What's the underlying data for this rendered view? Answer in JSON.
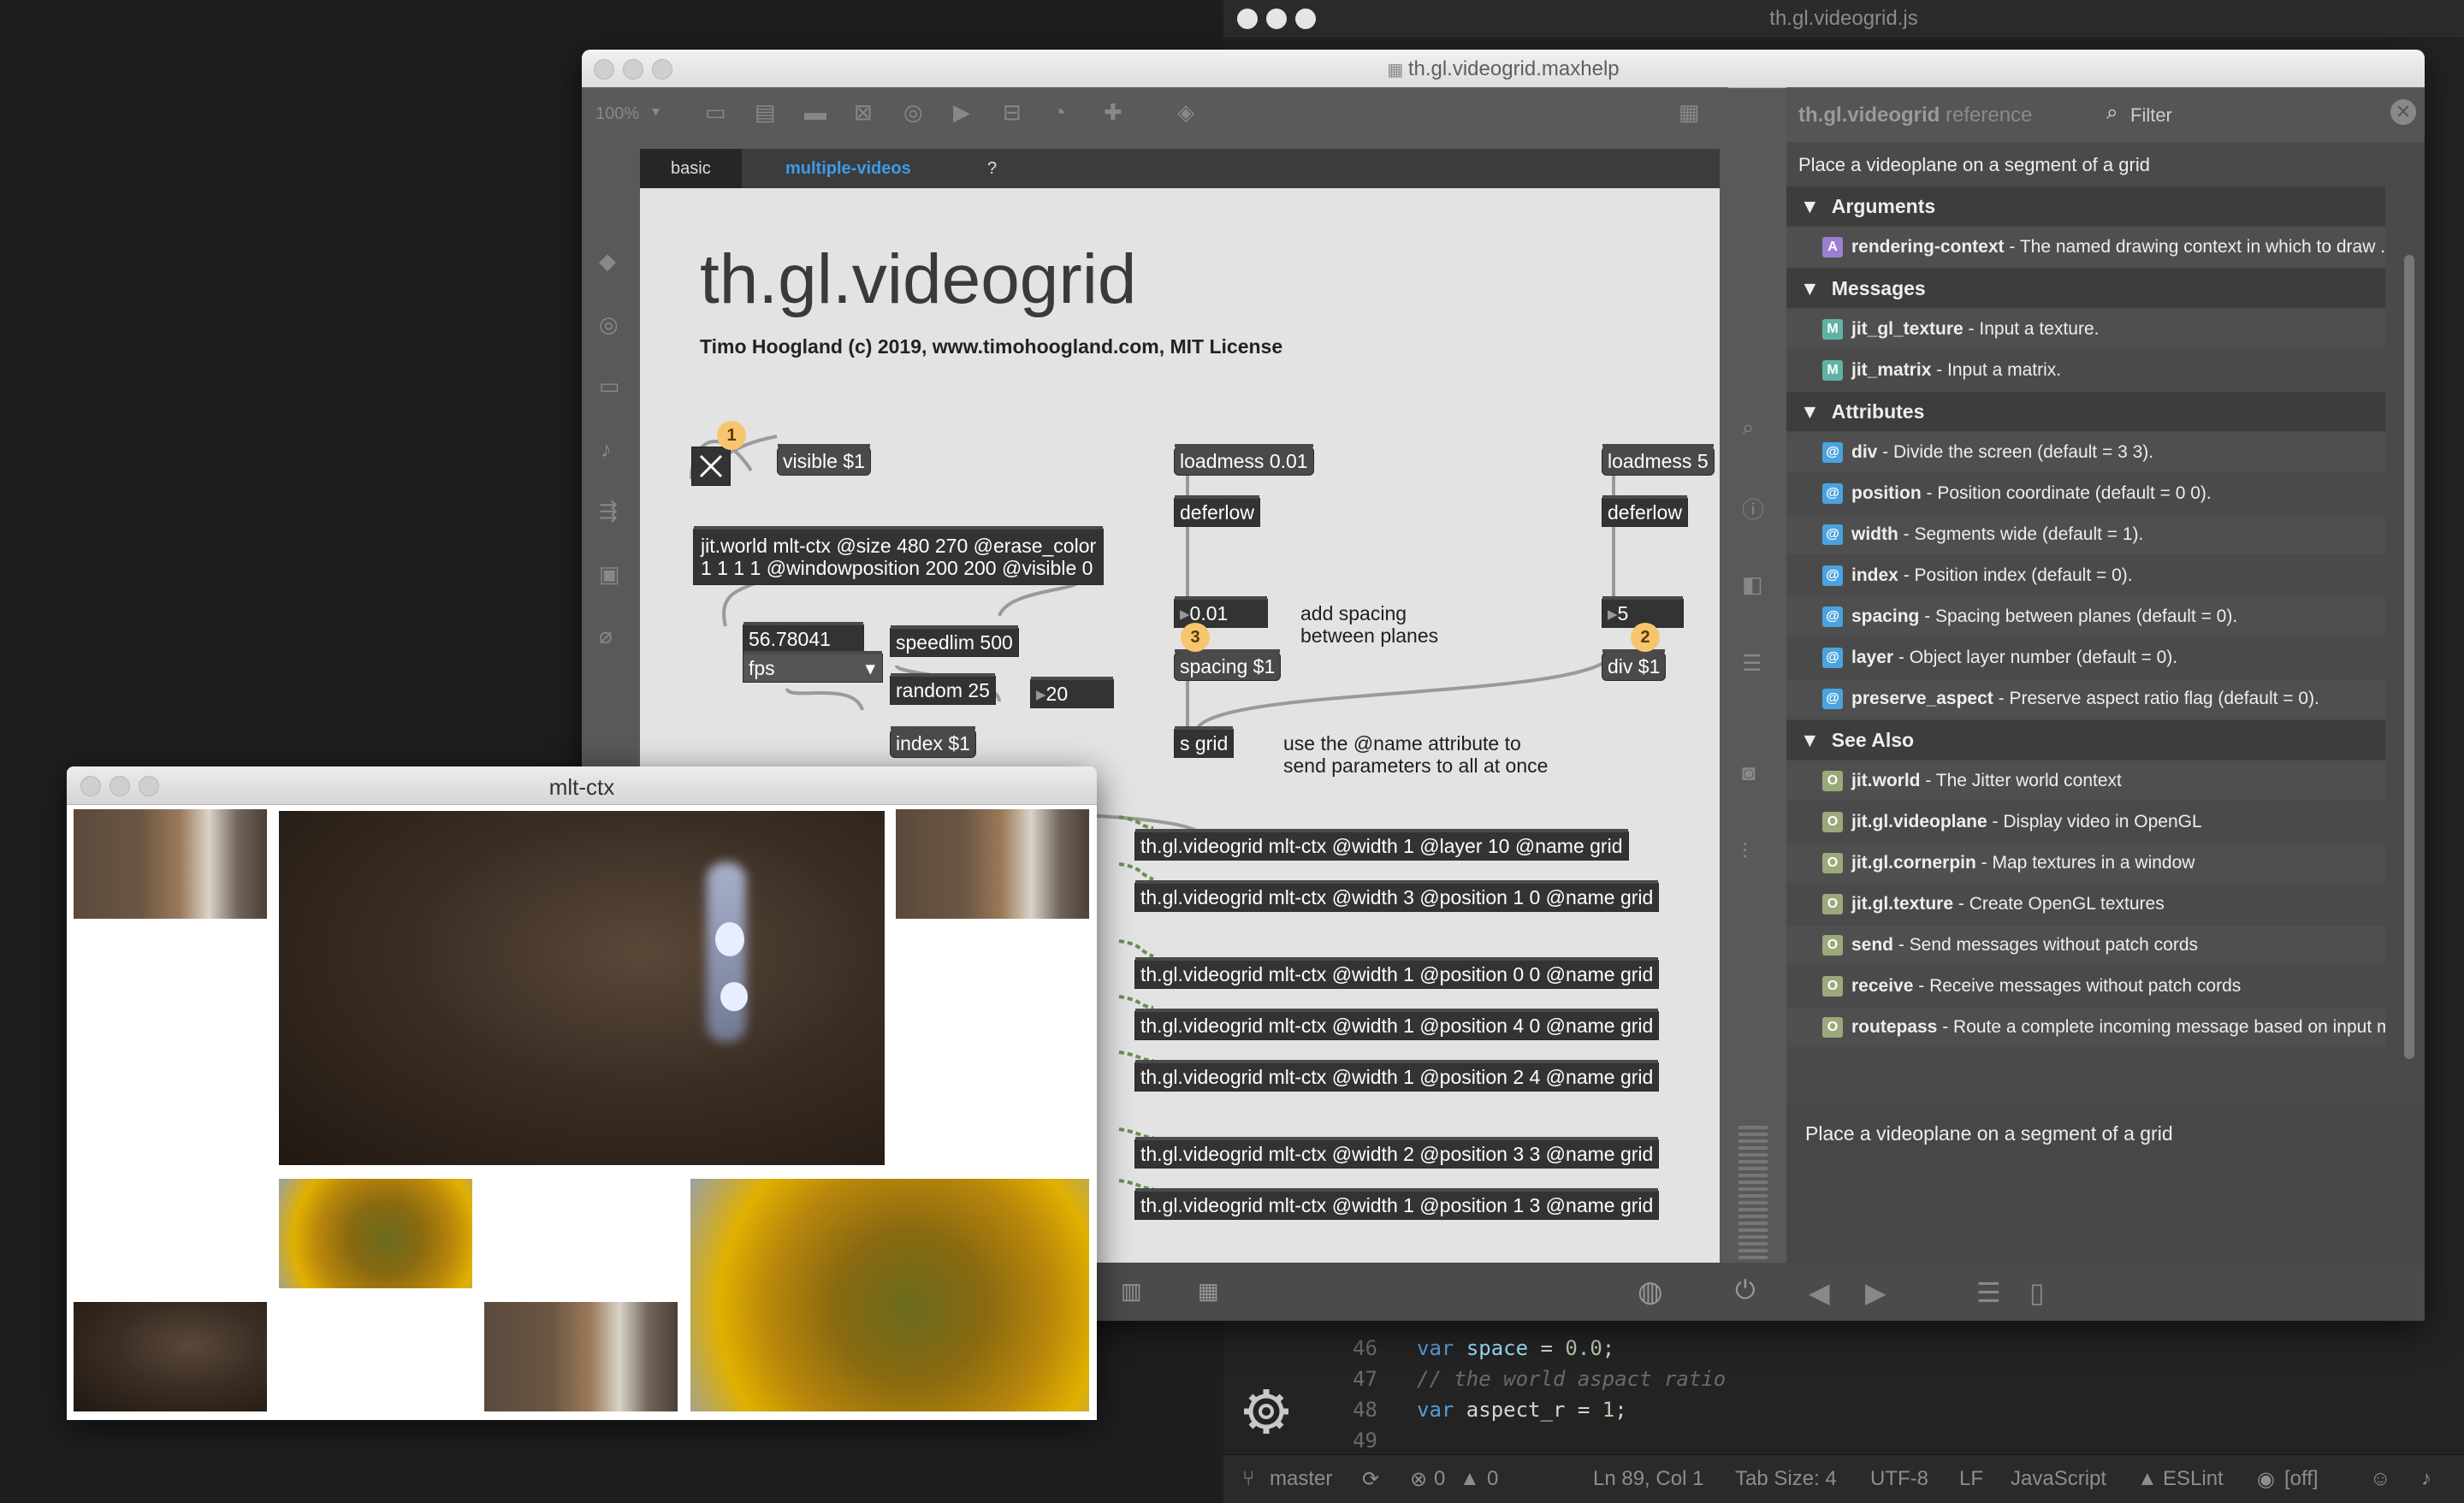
{
  "editor": {
    "title": "th.gl.videogrid.js",
    "lines": [
      {
        "num": "46",
        "text": "var space = 0.0;"
      },
      {
        "num": "47",
        "text": "// the world aspact ratio"
      },
      {
        "num": "48",
        "text": "var aspect_r = 1;"
      },
      {
        "num": "49",
        "text": ""
      }
    ],
    "status": {
      "branch": "master",
      "errors": "0",
      "warnings": "0",
      "position": "Ln 89, Col 1",
      "tabsize": "Tab Size: 4",
      "encoding": "UTF-8",
      "eol": "LF",
      "language": "JavaScript",
      "lint": "ESLint",
      "off": "[off]"
    }
  },
  "max": {
    "title": "th.gl.videogrid.maxhelp",
    "zoom": "100%",
    "tabs": [
      "basic",
      "multiple-videos",
      "?"
    ],
    "patch": {
      "title": "th.gl.videogrid",
      "subtitle": "Timo Hoogland (c) 2019, www.timohoogland.com, MIT License",
      "objects": {
        "visible": "visible $1",
        "jitworld1": "jit.world mlt-ctx @size 480 270 @erase_color",
        "jitworld2": "1 1 1 1 @windowposition 200 200 @visible 0",
        "fpsnum": "56.78041",
        "fps": "fps",
        "speedlim": "speedlim 500",
        "random": "random 25",
        "rnd_out": "20",
        "index": "index $1",
        "loadmess1": "loadmess 0.01",
        "deferlow1": "deferlow",
        "spacing_num": "0.01",
        "spacing": "spacing $1",
        "sgrid": "s grid",
        "loadmess2": "loadmess 5",
        "deferlow2": "deferlow",
        "div_num": "5",
        "div": "div $1",
        "vg1": "th.gl.videogrid mlt-ctx @width 1 @layer 10 @name grid",
        "vg2": "th.gl.videogrid mlt-ctx @width 3 @position 1 0 @name grid",
        "vg3": "th.gl.videogrid mlt-ctx @width 1 @position 0 0 @name grid",
        "vg4": "th.gl.videogrid mlt-ctx @width 1 @position 4 0 @name grid",
        "vg5": "th.gl.videogrid mlt-ctx @width 1 @position 2 4 @name grid",
        "vg6": "th.gl.videogrid mlt-ctx @width 2 @position 3 3 @name grid",
        "vg7": "th.gl.videogrid mlt-ctx @width 1 @position 1 3 @name grid"
      },
      "comments": {
        "spacing1": "add spacing",
        "spacing2": "between planes",
        "name1": "use the @name attribute to",
        "name2": "send parameters to all at once"
      },
      "badges": [
        "1",
        "2",
        "3"
      ]
    }
  },
  "ref": {
    "title": "th.gl.videogrid",
    "title_suffix": " reference",
    "filter": "Filter",
    "description": "Place a videoplane on a segment of a grid",
    "sections": {
      "arguments": "Arguments",
      "messages": "Messages",
      "attributes": "Attributes",
      "see_also": "See Also"
    },
    "arguments": [
      {
        "name": "rendering-context",
        "desc": " - The named drawing context in which to draw ..."
      }
    ],
    "messages": [
      {
        "name": "jit_gl_texture",
        "desc": " - Input a texture."
      },
      {
        "name": "jit_matrix",
        "desc": " - Input a matrix."
      }
    ],
    "attributes": [
      {
        "name": "div",
        "desc": " - Divide the screen (default = 3 3)."
      },
      {
        "name": "position",
        "desc": " - Position coordinate (default = 0 0)."
      },
      {
        "name": "width",
        "desc": " - Segments wide (default = 1)."
      },
      {
        "name": "index",
        "desc": " - Position index (default = 0)."
      },
      {
        "name": "spacing",
        "desc": " - Spacing between planes (default = 0)."
      },
      {
        "name": "layer",
        "desc": " - Object layer number (default = 0)."
      },
      {
        "name": "preserve_aspect",
        "desc": " - Preserve aspect ratio flag (default = 0)."
      }
    ],
    "see_also": [
      {
        "name": "jit.world",
        "desc": " - The Jitter world context"
      },
      {
        "name": "jit.gl.videoplane",
        "desc": " - Display video in OpenGL"
      },
      {
        "name": "jit.gl.cornerpin",
        "desc": " - Map textures in a window"
      },
      {
        "name": "jit.gl.texture",
        "desc": " - Create OpenGL textures"
      },
      {
        "name": "send",
        "desc": " - Send messages without patch cords"
      },
      {
        "name": "receive",
        "desc": " - Receive messages without patch cords"
      },
      {
        "name": "routepass",
        "desc": " - Route a complete incoming message based on input m..."
      }
    ],
    "bottom_desc": "Place a videoplane on a segment of a grid",
    "icon_letters": {
      "argument": "A",
      "message": "M",
      "attribute": "@",
      "see_also": "O"
    },
    "colors": {
      "argument": "#9b7fd0",
      "message": "#5fb3a5",
      "attribute": "#4aa3df",
      "see_also": "#9aa87a"
    }
  },
  "mlt": {
    "title": "mlt-ctx"
  }
}
